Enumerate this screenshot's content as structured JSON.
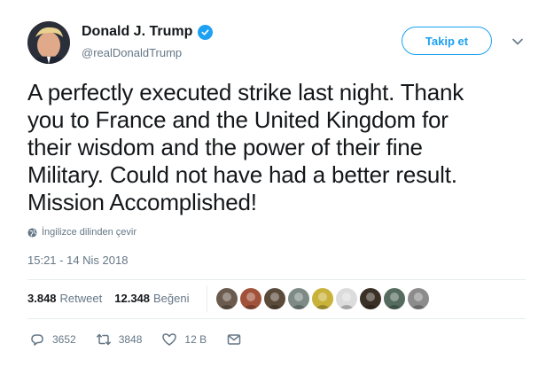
{
  "author": {
    "display_name": "Donald J. Trump",
    "handle": "@realDonaldTrump",
    "verified": true,
    "avatar_icon": "profile-photo"
  },
  "follow_label": "Takip et",
  "menu_icon": "chevron-down-icon",
  "tweet": {
    "text": "A perfectly executed strike last night. Thank\nyou to France and the United Kingdom for\ntheir wisdom and the power of their fine\nMilitary. Could not have had a better result.\nMission Accomplished!",
    "translate_label": "İngilizce dilinden çevir",
    "timestamp": "15:21 - 14 Nis 2018"
  },
  "stats": {
    "retweets_count": "3.848",
    "retweets_label": "Retweet",
    "likes_count": "12.348",
    "likes_label": "Beğeni"
  },
  "liker_avatar_colors": [
    "#6b5b4e",
    "#a0523a",
    "#5a4a3a",
    "#7d8a86",
    "#c9b23a",
    "#dcdcdc",
    "#3a3026",
    "#556b5e",
    "#8c8c8c"
  ],
  "actions": {
    "reply_count": "3652",
    "retweet_count": "3848",
    "like_count": "12 B"
  },
  "colors": {
    "accent": "#1da1f2",
    "text": "#14171a",
    "muted": "#657786",
    "divider": "#e6ecf0"
  }
}
